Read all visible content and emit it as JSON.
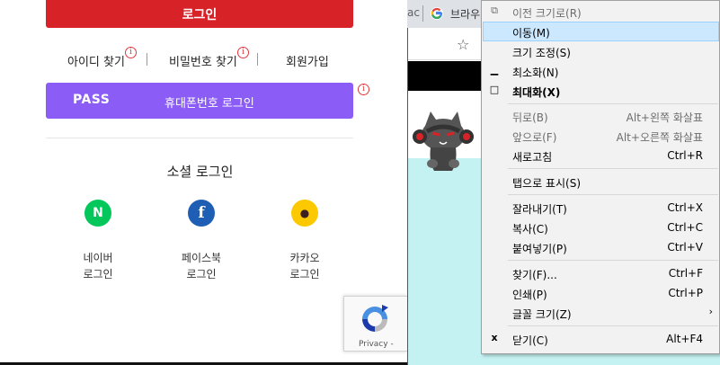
{
  "login": {
    "login_button": "로그인",
    "links": {
      "find_id": "아이디 찾기",
      "find_password": "비밀번호 찾기",
      "signup": "회원가입"
    },
    "info_glyph": "i",
    "pass": {
      "logo": "PASS",
      "label": "휴대폰번호 로그인"
    },
    "social_title": "소셜 로그인",
    "social": [
      {
        "name": "네이버",
        "sub": "로그인",
        "glyph": "N",
        "color": "#03c75a"
      },
      {
        "name": "페이스북",
        "sub": "로그인",
        "glyph": "f",
        "color": "#1877f2"
      },
      {
        "name": "카카오",
        "sub": "로그인",
        "glyph": "●",
        "color": "#fee500"
      }
    ],
    "recaptcha_text": "Privacy -"
  },
  "browser": {
    "prev_tab_text": "ac",
    "tab_title": "브라우",
    "star_icon": "bookmark-star-icon"
  },
  "context_menu": {
    "items": [
      {
        "label": "이전 크기로(R)",
        "glyph": "⧉",
        "shortcut": "",
        "disabled": true
      },
      {
        "label": "이동(M)",
        "glyph": "",
        "shortcut": "",
        "highlight": true
      },
      {
        "label": "크기 조정(S)",
        "glyph": "",
        "shortcut": ""
      },
      {
        "label": "최소화(N)",
        "glyph": "▁",
        "shortcut": ""
      },
      {
        "label": "최대화(X)",
        "glyph": "□",
        "shortcut": "",
        "bold": true
      },
      {
        "label": "뒤로(B)",
        "glyph": "",
        "shortcut": "Alt+왼쪽 화살표",
        "disabled": true
      },
      {
        "label": "앞으로(F)",
        "glyph": "",
        "shortcut": "Alt+오른쪽 화살표",
        "disabled": true
      },
      {
        "label": "새로고침",
        "glyph": "",
        "shortcut": "Ctrl+R"
      },
      {
        "label": "탭으로 표시(S)",
        "glyph": "",
        "shortcut": ""
      },
      {
        "label": "잘라내기(T)",
        "glyph": "",
        "shortcut": "Ctrl+X"
      },
      {
        "label": "복사(C)",
        "glyph": "",
        "shortcut": "Ctrl+C"
      },
      {
        "label": "붙여넣기(P)",
        "glyph": "",
        "shortcut": "Ctrl+V"
      },
      {
        "label": "찾기(F)...",
        "glyph": "",
        "shortcut": "Ctrl+F"
      },
      {
        "label": "인쇄(P)",
        "glyph": "",
        "shortcut": "Ctrl+P"
      },
      {
        "label": "글꼴 크기(Z)",
        "glyph": "",
        "shortcut": "",
        "submenu": true
      },
      {
        "label": "닫기(C)",
        "glyph": "x",
        "shortcut": "Alt+F4"
      }
    ],
    "submenu_arrow": "›"
  },
  "colors": {
    "login_red": "#d72328",
    "pass_purple": "#8b5cf6",
    "menu_highlight": "#cce8ff",
    "page_cyan": "#c4f2f2"
  }
}
